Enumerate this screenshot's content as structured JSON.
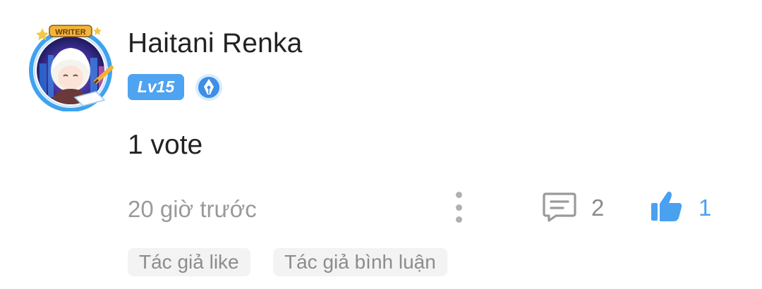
{
  "comment": {
    "username": "Haitani Renka",
    "level_badge": "Lv15",
    "frame_label": "WRITER",
    "content": "1 vote",
    "timestamp": "20 giờ trước",
    "comment_count": "2",
    "like_count": "1",
    "tags": [
      "Tác giả like",
      "Tác giả bình luận"
    ]
  },
  "icons": {
    "more": "more-vertical-icon",
    "comment": "comment-icon",
    "like": "thumbs-up-icon",
    "writer_badge": "pen-nib-badge-icon"
  },
  "colors": {
    "accent": "#4aa1f0",
    "level_badge_bg": "#4fa3f0",
    "muted_text": "#9a9a9a",
    "tag_bg": "#f3f3f3"
  }
}
